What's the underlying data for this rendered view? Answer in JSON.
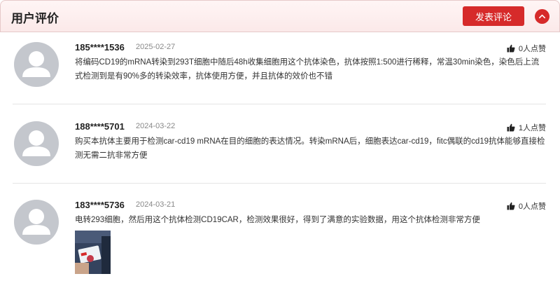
{
  "header": {
    "title": "用户评价",
    "post_label": "发表评论"
  },
  "reviews": [
    {
      "user": "185****1536",
      "date": "2025-02-27",
      "likes": "0人点赞",
      "text": "将编码CD19的mRNA转染到293T细胞中随后48h收集细胞用这个抗体染色，抗体按照1:500进行稀释，常温30min染色，染色后上流式检测到是有90%多的转染效率，抗体使用方便，并且抗体的效价也不错"
    },
    {
      "user": "188****5701",
      "date": "2024-03-22",
      "likes": "1人点赞",
      "text": "购买本抗体主要用于检测car-cd19 mRNA在目的细胞的表达情况。转染mRNA后，细胞表达car-cd19，fitc偶联的cd19抗体能够直接检测无需二抗非常方便"
    },
    {
      "user": "183****5736",
      "date": "2024-03-21",
      "likes": "0人点赞",
      "text": "电转293细胞，然后用这个抗体检测CD19CAR，检测效果很好，得到了满意的实验数据，用这个抗体检测非常方便"
    }
  ],
  "colors": {
    "accent": "#d62a2a",
    "avatar": "#c4c7cd",
    "header_bg": "#fbe9e9"
  },
  "icons": {
    "collapse": "chevron-up-icon",
    "like": "thumbs-up-icon",
    "avatar": "user-avatar-icon"
  }
}
